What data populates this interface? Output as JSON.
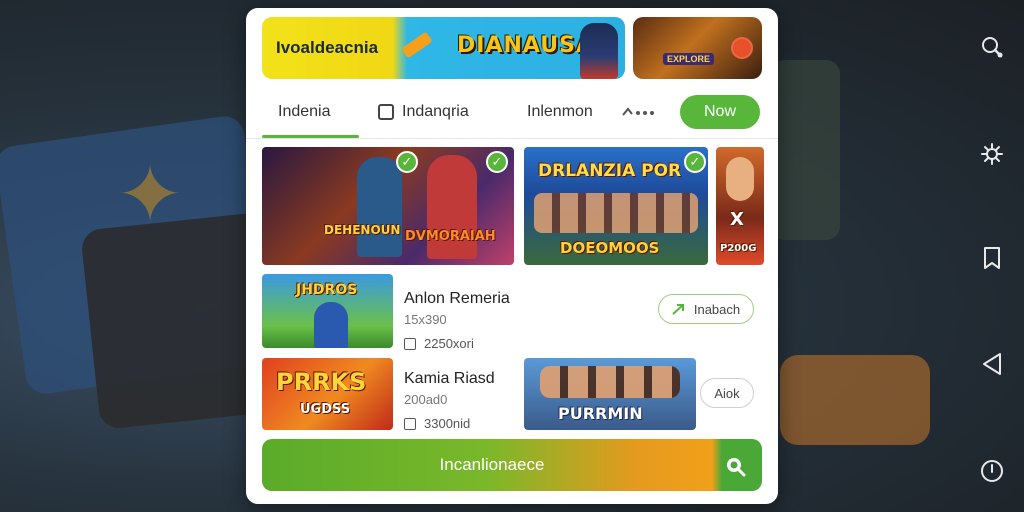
{
  "banner": {
    "promo_text": "Ivoaldeacnia",
    "logo_text": "DIANAUSA",
    "side_title": "EXPLORE"
  },
  "tabs": [
    {
      "label": "Indenia",
      "active": true
    },
    {
      "label": "Indanqria",
      "has_checkbox": true
    },
    {
      "label": "Inlenmon"
    }
  ],
  "new_button": {
    "label": "Now"
  },
  "featured": [
    {
      "caption": "DEHENOUN"
    },
    {
      "caption": "DVMORAIAH"
    },
    {
      "caption_top": "DRLANZIA POR",
      "caption_bottom": "DOEOMOOS"
    },
    {
      "caption_top": "X",
      "caption_bottom": "P200G"
    }
  ],
  "list": [
    {
      "thumb_text": "JHDROS",
      "title": "Anlon Remeria",
      "subtitle": "15x390",
      "count": "2250xori",
      "action": "Inabach"
    },
    {
      "thumb_text": "PRRKS",
      "thumb_sub": "UGDSS",
      "title": "Kamia Riasd",
      "subtitle": "200ad0",
      "count": "3300nid",
      "second_thumb_text": "PURRMIN",
      "action": "Aiok"
    }
  ],
  "cta": {
    "label": "Incanlionaece"
  },
  "colors": {
    "accent_green": "#58b63a",
    "cta_orange": "#f0a01a"
  },
  "rail_icons": [
    "search-icon",
    "settings-icon",
    "bookmark-icon",
    "back-icon",
    "clock-icon"
  ]
}
